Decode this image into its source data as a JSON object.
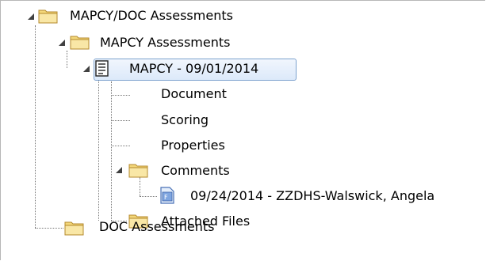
{
  "tree": {
    "root": {
      "label": "MAPCY/DOC Assessments",
      "expanded": true,
      "icon": "folder-open-icon"
    },
    "mapcy_assessments": {
      "label": "MAPCY Assessments",
      "expanded": true,
      "icon": "folder-open-icon"
    },
    "assessment": {
      "label": "MAPCY - 09/01/2014",
      "expanded": true,
      "selected": true,
      "icon": "document-form-icon"
    },
    "document": {
      "label": "Document"
    },
    "scoring": {
      "label": "Scoring"
    },
    "properties": {
      "label": "Properties"
    },
    "comments": {
      "label": "Comments",
      "expanded": true,
      "icon": "folder-open-icon"
    },
    "comment_entry": {
      "label": "09/24/2014 - ZZDHS-Walswick, Angela",
      "icon": "comment-file-icon"
    },
    "attached_files": {
      "label": "Attached Files",
      "icon": "folder-icon"
    },
    "doc_assessments": {
      "label": "DOC Assessments",
      "icon": "folder-icon"
    }
  },
  "colors": {
    "folder_fill": "#f3d77a",
    "folder_edge": "#b48a2c",
    "selection_border": "#7da2ce",
    "selection_fill": "#dce9fa"
  }
}
